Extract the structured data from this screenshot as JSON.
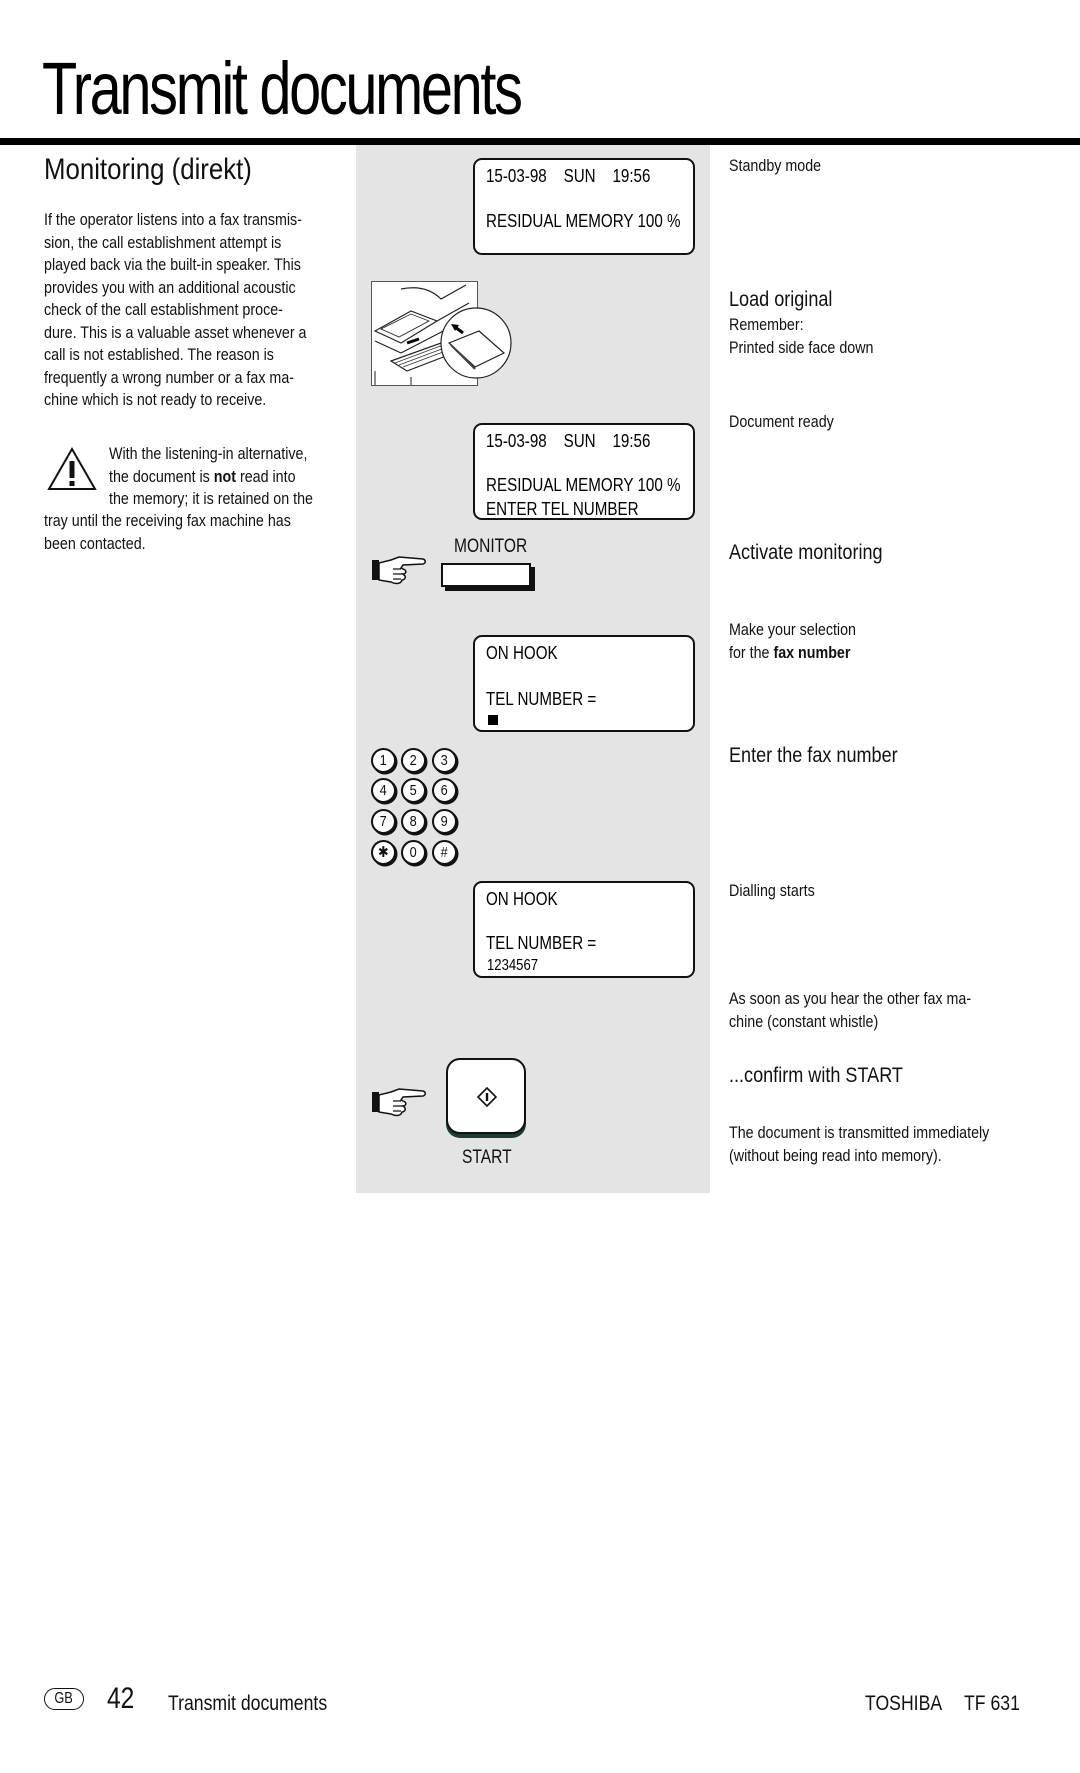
{
  "page": {
    "title": "Transmit documents",
    "section_title": "Monitoring (direkt)",
    "intro_lines": [
      "If the operator listens into a fax transmis-",
      "sion, the call establishment attempt is",
      "played back via the built-in speaker. This",
      "provides you with an additional acoustic",
      "check of the call establishment proce-",
      "dure. This is a valuable asset whenever a",
      "call is not established. The reason is",
      "frequently a wrong number or a fax ma-",
      "chine which is not ready to receive."
    ],
    "warning": {
      "icon": "warning-triangle-icon",
      "line1": "With the listening-in alternative,",
      "line2_pre": "the document is ",
      "line2_bold": "not",
      "line2_post": " read into",
      "line3": "the memory; it is retained on the",
      "line4": "tray until the receiving fax machine has",
      "line5": "been contacted."
    }
  },
  "displays": [
    {
      "line1": "15-03-98    SUN    19:56",
      "line2": "RESIDUAL MEMORY 100 %"
    },
    {
      "line1": "15-03-98    SUN    19:56",
      "line2": "RESIDUAL MEMORY 100 %",
      "line3": "ENTER TEL NUMBER"
    },
    {
      "line1": "ON HOOK",
      "line2": "TEL NUMBER =",
      "cursor": "■"
    },
    {
      "line1": "ON HOOK",
      "line2": "TEL NUMBER =",
      "line3": "1234567"
    }
  ],
  "controls": {
    "monitor_label": "MONITOR",
    "start_label": "START",
    "start_symbol": "◊",
    "keypad": [
      "1",
      "2",
      "3",
      "4",
      "5",
      "6",
      "7",
      "8",
      "9",
      "✱",
      "0",
      "#"
    ],
    "illustration": "load-original-illustration"
  },
  "steps": {
    "standby": "Standby mode",
    "load_original": "Load original",
    "remember": "Remember:",
    "printed_side": "Printed side face down",
    "document_ready": "Document ready",
    "activate_monitoring": "Activate monitoring",
    "make_selection": "Make your selection",
    "for_the": "for the ",
    "fax_number_bold": "fax number",
    "enter_fax_number": "Enter the fax number",
    "dialling_starts": "Dialling starts",
    "as_soon_1": "As soon as you hear the other fax ma-",
    "as_soon_2": "chine (constant whistle)",
    "confirm_start": "...confirm with START",
    "transmitted_1": "The document is transmitted immediately",
    "transmitted_2": "(without being read into memory)."
  },
  "footer": {
    "country": "GB",
    "page_number": "42",
    "section": "Transmit documents",
    "brand": "TOSHIBA",
    "model": "TF 631"
  }
}
